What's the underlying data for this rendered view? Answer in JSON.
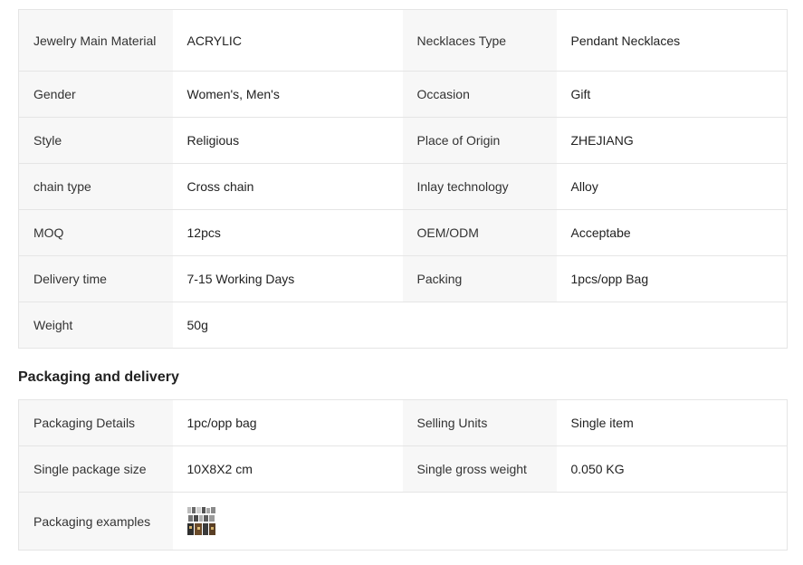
{
  "attributes": {
    "rows": [
      [
        {
          "k": "Jewelry Main Material",
          "v": "ACRYLIC"
        },
        {
          "k": "Necklaces Type",
          "v": "Pendant Necklaces"
        }
      ],
      [
        {
          "k": "Gender",
          "v": "Women's, Men's"
        },
        {
          "k": "Occasion",
          "v": "Gift"
        }
      ],
      [
        {
          "k": "Style",
          "v": "Religious"
        },
        {
          "k": "Place of Origin",
          "v": "ZHEJIANG"
        }
      ],
      [
        {
          "k": "chain type",
          "v": "Cross chain"
        },
        {
          "k": "Inlay technology",
          "v": "Alloy"
        }
      ],
      [
        {
          "k": "MOQ",
          "v": "12pcs"
        },
        {
          "k": "OEM/ODM",
          "v": "Acceptabe"
        }
      ],
      [
        {
          "k": "Delivery time",
          "v": "7-15 Working Days"
        },
        {
          "k": "Packing",
          "v": "1pcs/opp Bag"
        }
      ],
      [
        {
          "k": "Weight",
          "v": "50g"
        }
      ]
    ]
  },
  "packaging": {
    "title": "Packaging and delivery",
    "rows": [
      [
        {
          "k": "Packaging Details",
          "v": "1pc/opp bag"
        },
        {
          "k": "Selling Units",
          "v": "Single item"
        }
      ],
      [
        {
          "k": "Single package size",
          "v": "10X8X2 cm"
        },
        {
          "k": "Single gross weight",
          "v": "0.050 KG"
        }
      ]
    ],
    "examples_label": "Packaging examples",
    "examples_icon": "packaging-thumbnail-icon"
  }
}
